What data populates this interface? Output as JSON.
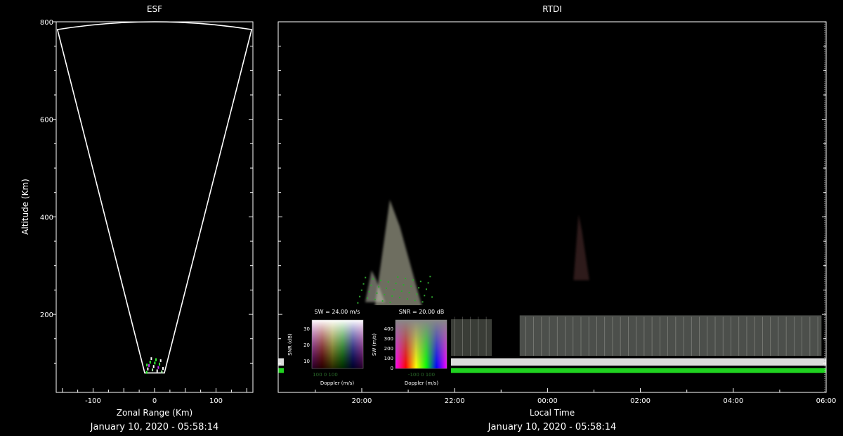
{
  "chart_data": [
    {
      "type": "fan",
      "title": "ESF",
      "xlabel": "Zonal Range (Km)",
      "ylabel": "Altitude (Km)",
      "xlim": [
        -160,
        160
      ],
      "ylim": [
        40,
        800
      ],
      "x_ticks": [
        -100,
        0,
        100
      ],
      "y_ticks": [
        200,
        400,
        600,
        800
      ],
      "fan_apex_altitude": 80,
      "fan_top_altitude": 800,
      "fan_edge_range": [
        -158,
        158
      ],
      "footer": "January 10, 2020 - 05:58:14"
    },
    {
      "type": "heatmap",
      "title": "RTDI",
      "xlabel": "Local Time",
      "x_ticks": [
        "20:00",
        "22:00",
        "00:00",
        "02:00",
        "04:00",
        "06:00"
      ],
      "x_tick_hours": [
        20,
        22,
        24,
        26,
        28,
        30
      ],
      "xlim_hours": [
        18.2,
        30
      ],
      "ylim": [
        40,
        800
      ],
      "footer": "January 10, 2020 - 05:58:14",
      "bands": [
        {
          "kind": "layer",
          "t_start": 18.2,
          "t_end": 30,
          "alt_low": 80,
          "alt_high": 90,
          "color": "#22dd22"
        },
        {
          "kind": "layer",
          "t_start": 18.2,
          "t_end": 30,
          "alt_low": 95,
          "alt_high": 110,
          "color": "#e8e8e8"
        },
        {
          "kind": "layer",
          "t_start": 20.3,
          "t_end": 21.8,
          "alt_low": 110,
          "alt_high": 195,
          "color": "#9aa090"
        },
        {
          "kind": "layer",
          "t_start": 21.8,
          "t_end": 22.8,
          "alt_low": 115,
          "alt_high": 190,
          "color": "#6a7064"
        },
        {
          "kind": "layer",
          "t_start": 23.4,
          "t_end": 29.9,
          "alt_low": 115,
          "alt_high": 198,
          "color": "#8a9088"
        },
        {
          "kind": "plume",
          "t_start": 20.1,
          "t_end": 21.3,
          "alt_low": 215,
          "alt_high": 435,
          "color": "#c8c8b0"
        },
        {
          "kind": "plume",
          "t_start": 20.0,
          "t_end": 20.5,
          "alt_low": 225,
          "alt_high": 290,
          "color": "#c0c0b0"
        },
        {
          "kind": "plume",
          "t_start": 24.5,
          "t_end": 24.9,
          "alt_low": 270,
          "alt_high": 405,
          "color": "#553030"
        }
      ]
    }
  ],
  "legends": [
    {
      "title": "SW = 24.00 m/s",
      "ylabel": "SNR (dB)",
      "xlabel": "Doppler (m/s)",
      "y_ticks": [
        "30",
        "20",
        "10"
      ],
      "background_label": "100 0 100"
    },
    {
      "title": "SNR = 20.00 dB",
      "ylabel": "SW (m/s)",
      "xlabel": "Doppler (m/s)",
      "y_ticks": [
        "400",
        "300",
        "200",
        "100",
        "0"
      ],
      "background_label": "-100 0 100"
    }
  ]
}
